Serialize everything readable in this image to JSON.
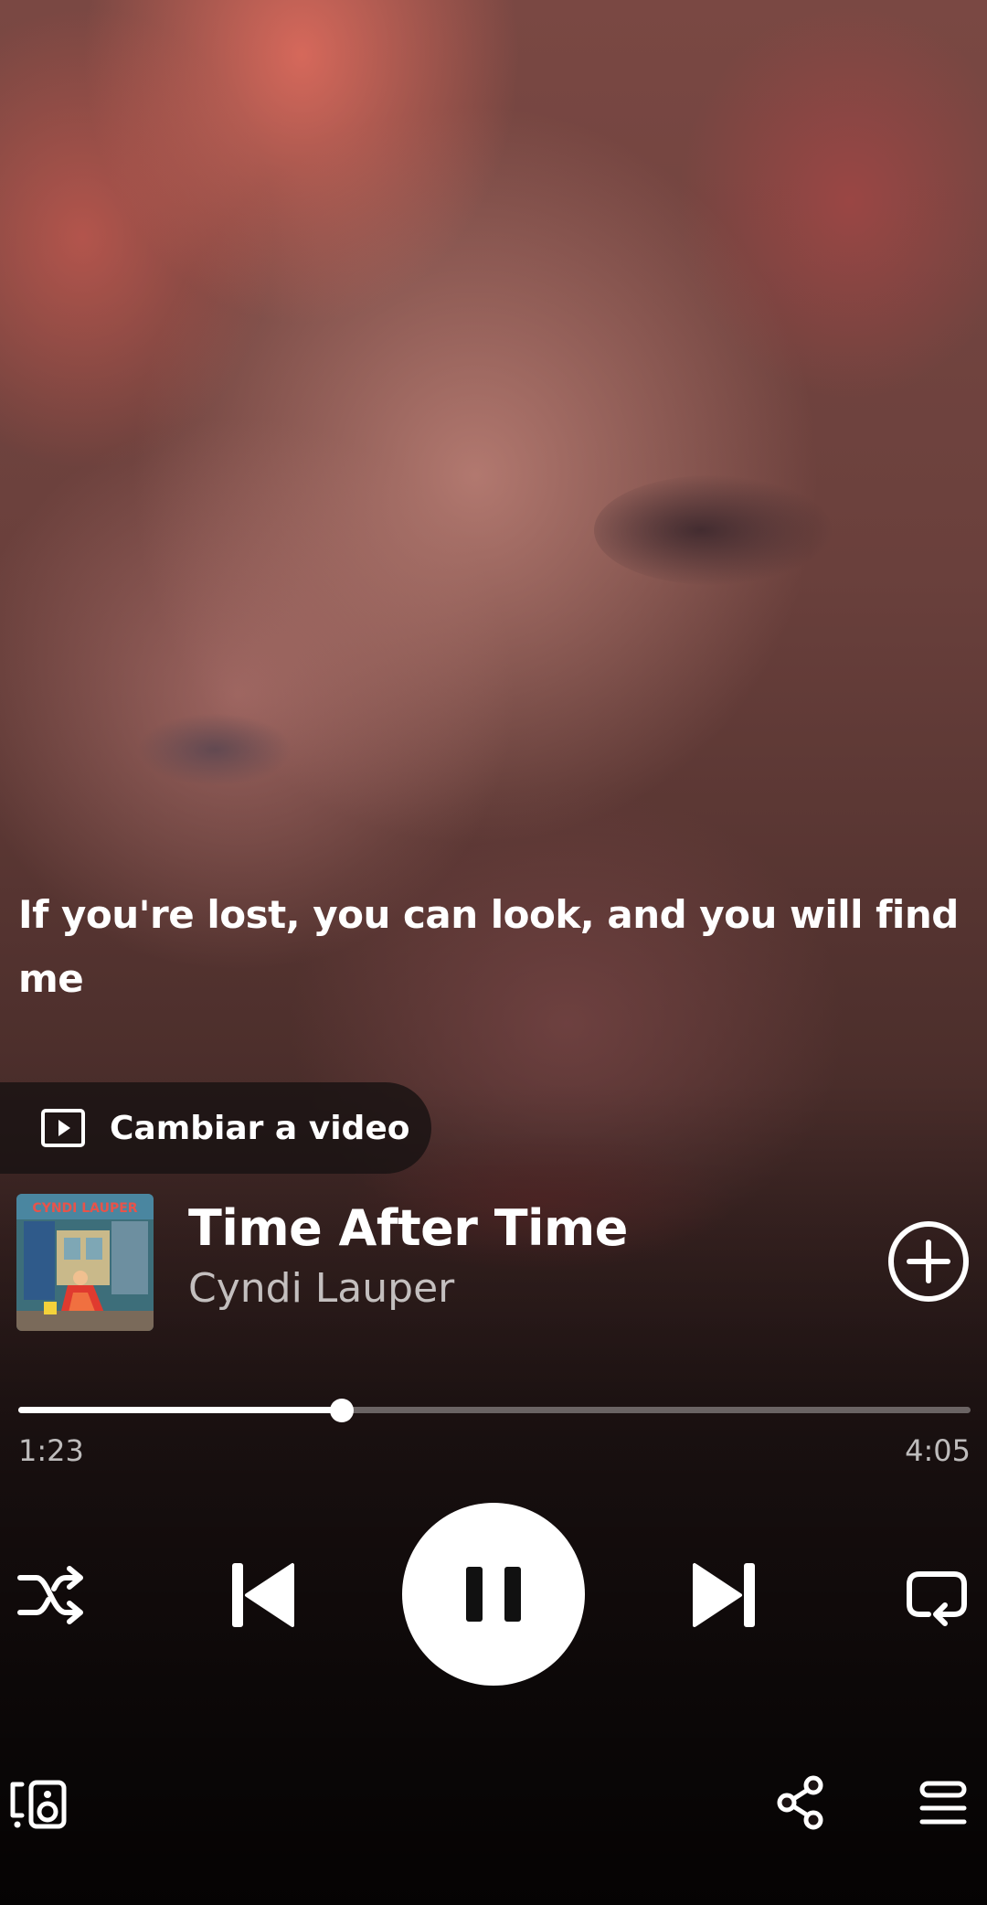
{
  "lyrics": {
    "current_line": "If you're lost, you can look, and you will find me"
  },
  "video_toggle": {
    "label": "Cambiar a video",
    "icon": "play-square-icon"
  },
  "track": {
    "title": "Time After Time",
    "artist": "Cyndi Lauper",
    "cover_text": "CYNDI LAUPER",
    "add_icon": "plus-circle-icon"
  },
  "playback": {
    "elapsed": "1:23",
    "duration": "4:05",
    "progress_fraction": 0.34,
    "state": "playing"
  },
  "controls": {
    "shuffle_icon": "shuffle-icon",
    "previous_icon": "skip-previous-icon",
    "pause_icon": "pause-icon",
    "next_icon": "skip-next-icon",
    "repeat_icon": "repeat-icon"
  },
  "footer": {
    "devices_icon": "connect-devices-icon",
    "share_icon": "share-icon",
    "queue_icon": "queue-icon"
  },
  "colors": {
    "foreground": "#ffffff",
    "secondary_text": "#b8b0b0",
    "toggle_background": "#191212"
  }
}
